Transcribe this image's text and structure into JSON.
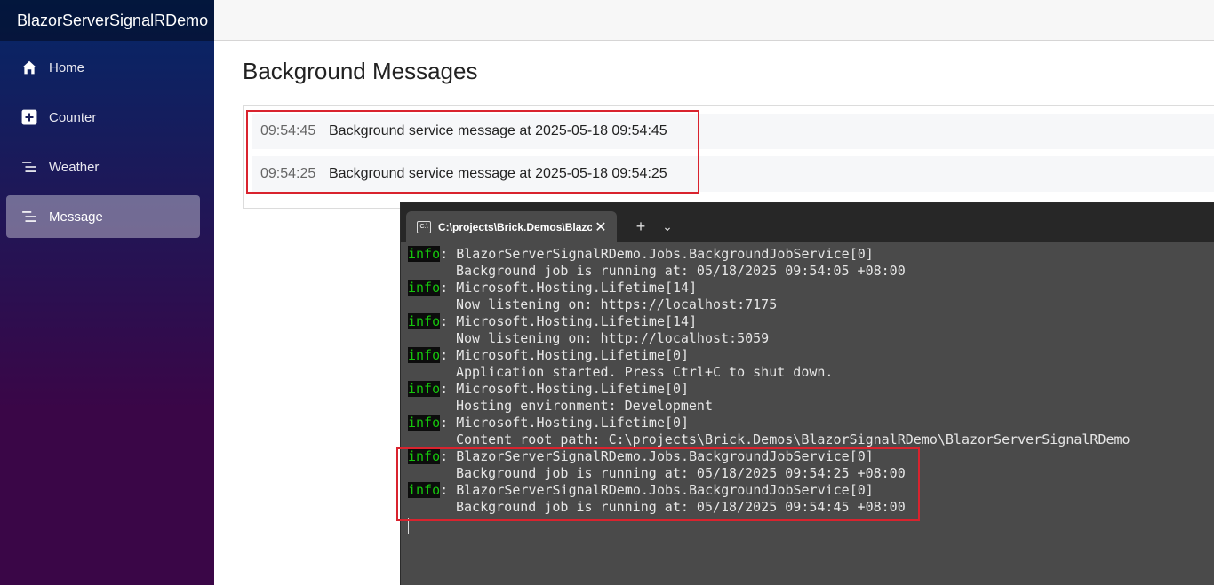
{
  "app": {
    "brand": "BlazorServerSignalRDemo"
  },
  "sidebar": {
    "items": [
      {
        "label": "Home",
        "icon": "home-icon"
      },
      {
        "label": "Counter",
        "icon": "plus-square-icon"
      },
      {
        "label": "Weather",
        "icon": "list-icon"
      },
      {
        "label": "Message",
        "icon": "list-icon",
        "active": true
      }
    ]
  },
  "page": {
    "title": "Background Messages",
    "messages": [
      {
        "time": "09:54:45",
        "text": "Background service message at 2025-05-18 09:54:45"
      },
      {
        "time": "09:54:25",
        "text": "Background service message at 2025-05-18 09:54:25"
      }
    ]
  },
  "terminal": {
    "tab_title": "C:\\projects\\Brick.Demos\\Blazc",
    "new_tab": "+",
    "dropdown": "⌄",
    "close": "✕",
    "tab_icon_text": "C:\\",
    "level": "info",
    "log": [
      {
        "source": "BlazorServerSignalRDemo.Jobs.BackgroundJobService[0]",
        "message": "Background job is running at: 05/18/2025 09:54:05 +08:00"
      },
      {
        "source": "Microsoft.Hosting.Lifetime[14]",
        "message": "Now listening on: https://localhost:7175"
      },
      {
        "source": "Microsoft.Hosting.Lifetime[14]",
        "message": "Now listening on: http://localhost:5059"
      },
      {
        "source": "Microsoft.Hosting.Lifetime[0]",
        "message": "Application started. Press Ctrl+C to shut down."
      },
      {
        "source": "Microsoft.Hosting.Lifetime[0]",
        "message": "Hosting environment: Development"
      },
      {
        "source": "Microsoft.Hosting.Lifetime[0]",
        "message": "Content root path: C:\\projects\\Brick.Demos\\BlazorSignalRDemo\\BlazorServerSignalRDemo"
      },
      {
        "source": "BlazorServerSignalRDemo.Jobs.BackgroundJobService[0]",
        "message": "Background job is running at: 05/18/2025 09:54:25 +08:00"
      },
      {
        "source": "BlazorServerSignalRDemo.Jobs.BackgroundJobService[0]",
        "message": "Background job is running at: 05/18/2025 09:54:45 +08:00"
      }
    ]
  },
  "colors": {
    "highlight": "#d9232e",
    "info_green": "#16c60c"
  }
}
